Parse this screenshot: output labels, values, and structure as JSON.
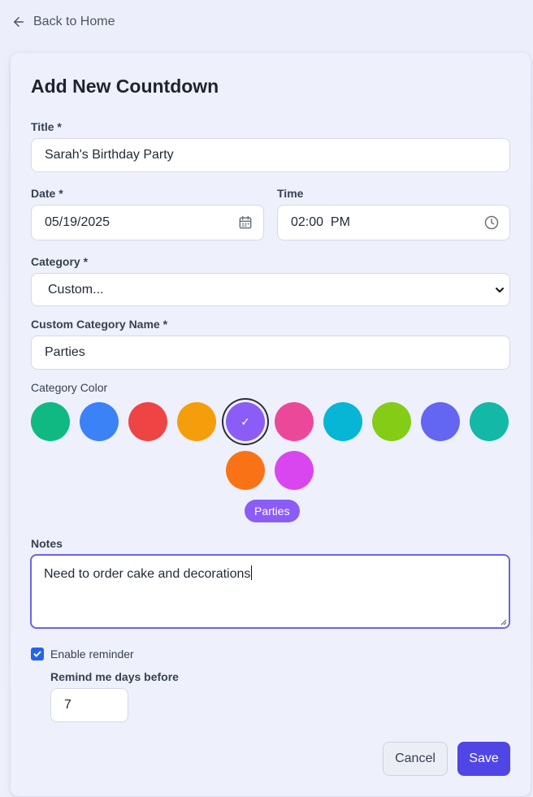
{
  "nav": {
    "back_label": "Back to Home"
  },
  "form": {
    "heading": "Add New Countdown",
    "title_label": "Title *",
    "title_value": "Sarah's Birthday Party",
    "date_label": "Date *",
    "date_value": "05/19/2025",
    "time_label": "Time",
    "time_value": "02:00  PM",
    "category_label": "Category *",
    "category_value": "Custom...",
    "custom_name_label": "Custom Category Name *",
    "custom_name_value": "Parties",
    "color_label": "Category Color",
    "colors": [
      "#10b981",
      "#3b82f6",
      "#ef4444",
      "#f59e0b",
      "#8b5cf6",
      "#ec4899",
      "#06b6d4",
      "#84cc16",
      "#6366f1",
      "#14b8a6",
      "#f97316",
      "#d946ef"
    ],
    "selected_color_index": 4,
    "selected_mark": "✓",
    "preview_label": "Parties",
    "notes_label": "Notes",
    "notes_value": "Need to order cake and decorations",
    "reminder_label": "Enable reminder",
    "reminder_checked": true,
    "remind_days_label": "Remind me days before",
    "remind_days_value": "7",
    "cancel_label": "Cancel",
    "save_label": "Save"
  }
}
